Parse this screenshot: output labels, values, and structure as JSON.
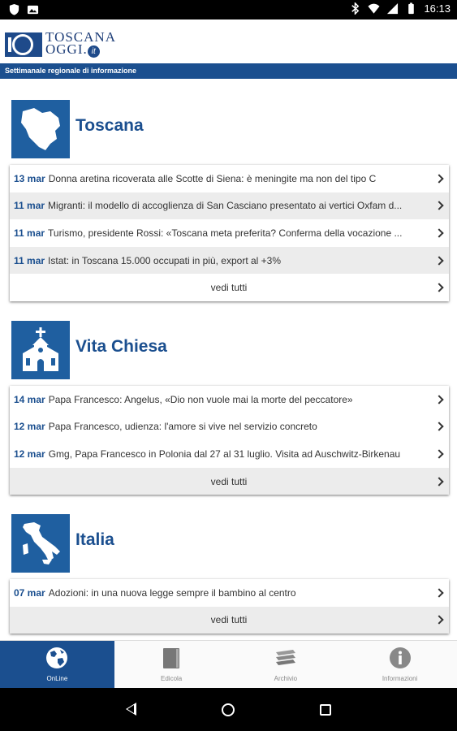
{
  "status_bar": {
    "time": "16:13",
    "icons": [
      "shield-icon",
      "image-icon",
      "bluetooth-icon",
      "wifi-icon",
      "signal-icon",
      "battery-icon"
    ]
  },
  "header": {
    "logo_line1": "TOSCANA",
    "logo_line2": "OGGI.",
    "logo_badge": "it",
    "tagline": "Settimanale regionale di informazione"
  },
  "sections": [
    {
      "title": "Toscana",
      "icon": "tuscany-map-icon",
      "items": [
        {
          "date": "13 mar",
          "text": "Donna aretina ricoverata alle Scotte di Siena: è meningite ma non del tipo C"
        },
        {
          "date": "11 mar",
          "text": "Migranti: il modello di accoglienza di San Casciano presentato ai vertici Oxfam d..."
        },
        {
          "date": "11 mar",
          "text": "Turismo, presidente Rossi: «Toscana meta preferita? Conferma della vocazione ..."
        },
        {
          "date": "11 mar",
          "text": "Istat: in Toscana 15.000 occupati in più, export al +3%"
        }
      ],
      "see_all": "vedi tutti"
    },
    {
      "title": "Vita Chiesa",
      "icon": "church-icon",
      "items": [
        {
          "date": "14 mar",
          "text": "Papa Francesco: Angelus, «Dio non vuole mai la morte del peccatore»"
        },
        {
          "date": "12 mar",
          "text": "Papa Francesco, udienza: l'amore si vive nel servizio concreto"
        },
        {
          "date": "12 mar",
          "text": "Gmg, Papa Francesco in Polonia dal 27 al 31 luglio. Visita ad Auschwitz-Birkenau"
        }
      ],
      "see_all": "vedi tutti"
    },
    {
      "title": "Italia",
      "icon": "italy-map-icon",
      "items": [
        {
          "date": "07 mar",
          "text": "Adozioni: in una nuova legge sempre il bambino al centro"
        }
      ],
      "see_all": "vedi tutti"
    }
  ],
  "tabs": [
    {
      "label": "OnLine",
      "icon": "globe-icon",
      "active": true
    },
    {
      "label": "Edicola",
      "icon": "book-icon",
      "active": false
    },
    {
      "label": "Archivio",
      "icon": "archive-icon",
      "active": false
    },
    {
      "label": "Informazioni",
      "icon": "info-icon",
      "active": false
    }
  ],
  "colors": {
    "brand_blue": "#1b4f8f",
    "icon_blue": "#1f5fa0",
    "row_alt": "#ececec"
  }
}
